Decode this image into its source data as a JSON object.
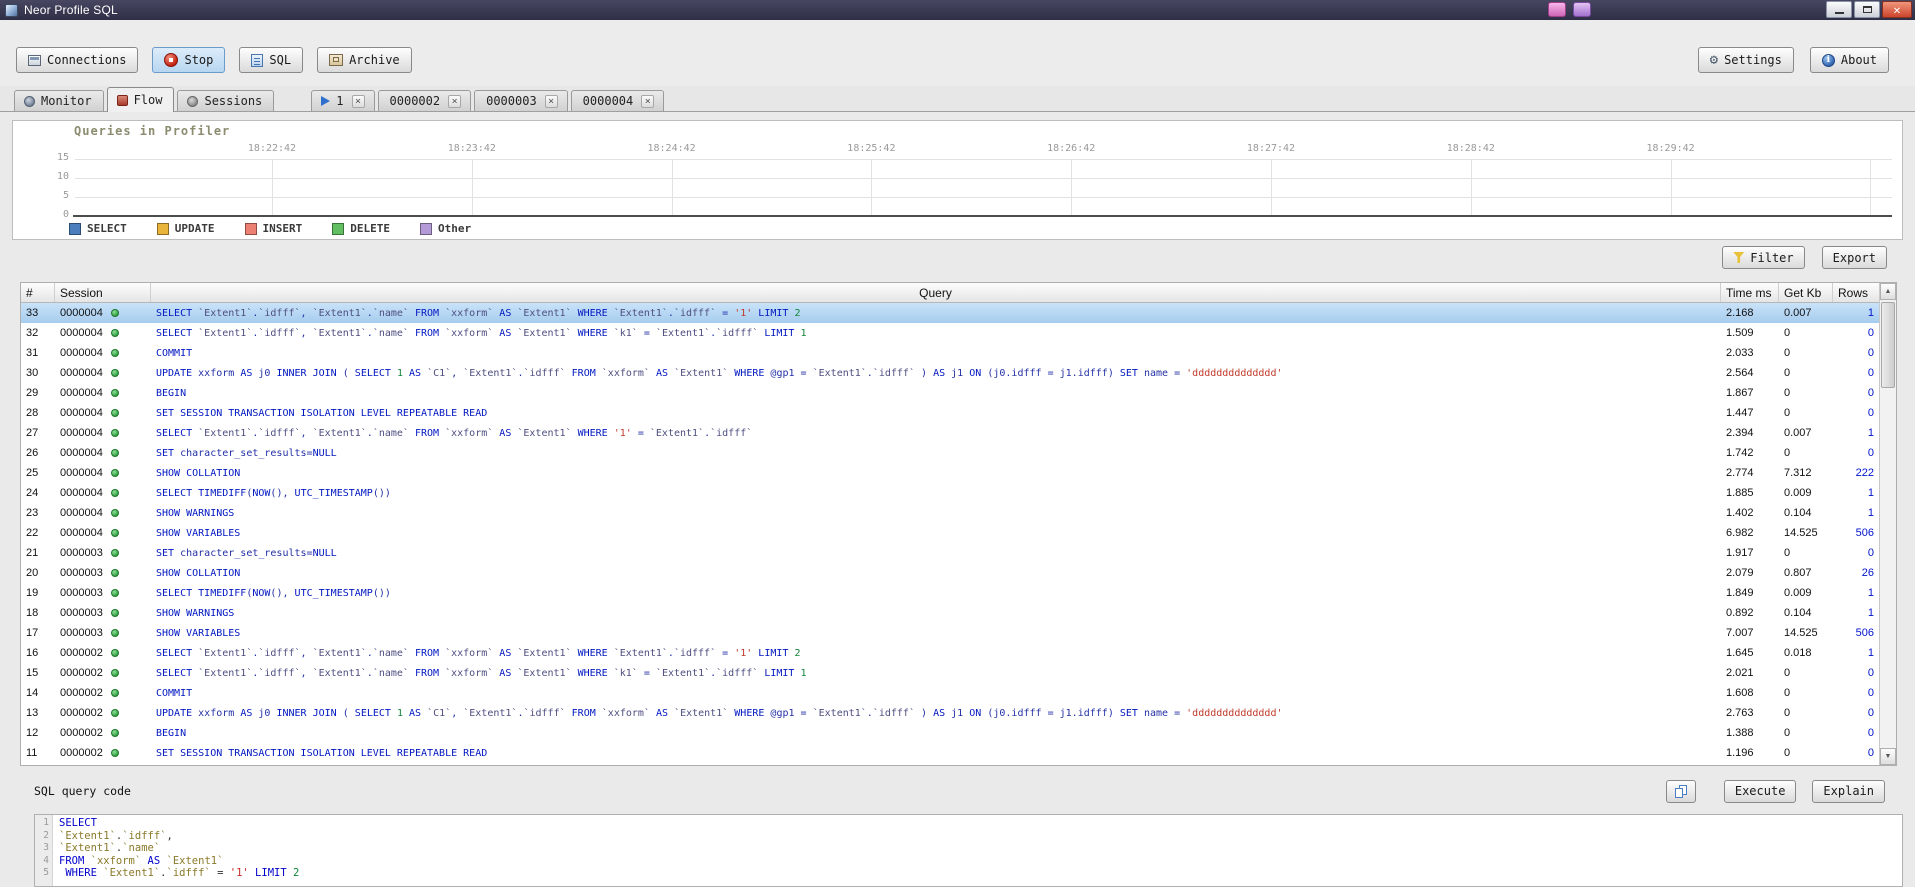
{
  "window": {
    "title": "Neor Profile SQL"
  },
  "toolbar": {
    "connections": "Connections",
    "stop": "Stop",
    "sql": "SQL",
    "archive": "Archive",
    "settings": "Settings",
    "about": "About"
  },
  "tabs": [
    {
      "label": "Monitor",
      "icon": "monitor"
    },
    {
      "label": "Flow",
      "icon": "flow",
      "active": true
    },
    {
      "label": "Sessions",
      "icon": "sessions"
    },
    {
      "label": "1",
      "icon": "play",
      "closable": true,
      "gap_before": true
    },
    {
      "label": "0000002",
      "closable": true
    },
    {
      "label": "0000003",
      "closable": true
    },
    {
      "label": "0000004",
      "closable": true
    }
  ],
  "profiler_chart": {
    "title": "Queries in Profiler",
    "type": "line",
    "x_labels": [
      "18:22:42",
      "18:23:42",
      "18:24:42",
      "18:25:42",
      "18:26:42",
      "18:27:42",
      "18:28:42",
      "18:29:42"
    ],
    "y_labels": [
      "15",
      "10",
      "5",
      "0"
    ],
    "y_range": [
      0,
      15
    ],
    "grid": true,
    "legend": [
      {
        "label": "SELECT",
        "color": "#4a7ebc"
      },
      {
        "label": "UPDATE",
        "color": "#e9b53a"
      },
      {
        "label": "INSERT",
        "color": "#ec8073"
      },
      {
        "label": "DELETE",
        "color": "#61bf61"
      },
      {
        "label": "Other",
        "color": "#b49bd8"
      }
    ]
  },
  "table": {
    "filter_label": "Filter",
    "export_label": "Export",
    "headers": {
      "num": "#",
      "session": "Session",
      "query": "Query",
      "time": "Time ms",
      "kb": "Get Kb",
      "rows": "Rows"
    },
    "rows": [
      {
        "num": 33,
        "session": "0000004",
        "query": "SELECT `Extent1`.`idfff`, `Extent1`.`name` FROM `xxform` AS `Extent1` WHERE `Extent1`.`idfff` = '1' LIMIT 2",
        "time": "2.168",
        "kb": "0.007",
        "rows": "1",
        "selected": true
      },
      {
        "num": 32,
        "session": "0000004",
        "query": "SELECT `Extent1`.`idfff`, `Extent1`.`name` FROM `xxform` AS `Extent1` WHERE `k1` = `Extent1`.`idfff` LIMIT 1",
        "time": "1.509",
        "kb": "0",
        "rows": "0"
      },
      {
        "num": 31,
        "session": "0000004",
        "query": "COMMIT",
        "time": "2.033",
        "kb": "0",
        "rows": "0"
      },
      {
        "num": 30,
        "session": "0000004",
        "query": "UPDATE xxform AS j0 INNER JOIN ( SELECT 1 AS `C1`, `Extent1`.`idfff` FROM `xxform` AS `Extent1` WHERE @gp1 = `Extent1`.`idfff` ) AS j1 ON (j0.idfff = j1.idfff) SET name = 'dddddddddddddd'",
        "time": "2.564",
        "kb": "0",
        "rows": "0"
      },
      {
        "num": 29,
        "session": "0000004",
        "query": "BEGIN",
        "time": "1.867",
        "kb": "0",
        "rows": "0"
      },
      {
        "num": 28,
        "session": "0000004",
        "query": "SET SESSION TRANSACTION ISOLATION LEVEL REPEATABLE READ",
        "time": "1.447",
        "kb": "0",
        "rows": "0"
      },
      {
        "num": 27,
        "session": "0000004",
        "query": "SELECT `Extent1`.`idfff`, `Extent1`.`name` FROM `xxform` AS `Extent1` WHERE '1' = `Extent1`.`idfff`",
        "time": "2.394",
        "kb": "0.007",
        "rows": "1"
      },
      {
        "num": 26,
        "session": "0000004",
        "query": "SET character_set_results=NULL",
        "time": "1.742",
        "kb": "0",
        "rows": "0"
      },
      {
        "num": 25,
        "session": "0000004",
        "query": "SHOW COLLATION",
        "time": "2.774",
        "kb": "7.312",
        "rows": "222"
      },
      {
        "num": 24,
        "session": "0000004",
        "query": "SELECT TIMEDIFF(NOW(), UTC_TIMESTAMP())",
        "time": "1.885",
        "kb": "0.009",
        "rows": "1"
      },
      {
        "num": 23,
        "session": "0000004",
        "query": "SHOW WARNINGS",
        "time": "1.402",
        "kb": "0.104",
        "rows": "1"
      },
      {
        "num": 22,
        "session": "0000004",
        "query": "SHOW VARIABLES",
        "time": "6.982",
        "kb": "14.525",
        "rows": "506"
      },
      {
        "num": 21,
        "session": "0000003",
        "query": "SET character_set_results=NULL",
        "time": "1.917",
        "kb": "0",
        "rows": "0"
      },
      {
        "num": 20,
        "session": "0000003",
        "query": "SHOW COLLATION",
        "time": "2.079",
        "kb": "0.807",
        "rows": "26"
      },
      {
        "num": 19,
        "session": "0000003",
        "query": "SELECT TIMEDIFF(NOW(), UTC_TIMESTAMP())",
        "time": "1.849",
        "kb": "0.009",
        "rows": "1"
      },
      {
        "num": 18,
        "session": "0000003",
        "query": "SHOW WARNINGS",
        "time": "0.892",
        "kb": "0.104",
        "rows": "1"
      },
      {
        "num": 17,
        "session": "0000003",
        "query": "SHOW VARIABLES",
        "time": "7.007",
        "kb": "14.525",
        "rows": "506"
      },
      {
        "num": 16,
        "session": "0000002",
        "query": "SELECT `Extent1`.`idfff`, `Extent1`.`name` FROM `xxform` AS `Extent1` WHERE `Extent1`.`idfff` = '1' LIMIT 2",
        "time": "1.645",
        "kb": "0.018",
        "rows": "1"
      },
      {
        "num": 15,
        "session": "0000002",
        "query": "SELECT `Extent1`.`idfff`, `Extent1`.`name` FROM `xxform` AS `Extent1` WHERE `k1` = `Extent1`.`idfff` LIMIT 1",
        "time": "2.021",
        "kb": "0",
        "rows": "0"
      },
      {
        "num": 14,
        "session": "0000002",
        "query": "COMMIT",
        "time": "1.608",
        "kb": "0",
        "rows": "0"
      },
      {
        "num": 13,
        "session": "0000002",
        "query": "UPDATE xxform AS j0 INNER JOIN ( SELECT 1 AS `C1`, `Extent1`.`idfff` FROM `xxform` AS `Extent1` WHERE @gp1 = `Extent1`.`idfff` ) AS j1 ON (j0.idfff = j1.idfff) SET name = 'dddddddddddddd'",
        "time": "2.763",
        "kb": "0",
        "rows": "0"
      },
      {
        "num": 12,
        "session": "0000002",
        "query": "BEGIN",
        "time": "1.388",
        "kb": "0",
        "rows": "0"
      },
      {
        "num": 11,
        "session": "0000002",
        "query": "SET SESSION TRANSACTION ISOLATION LEVEL REPEATABLE READ",
        "time": "1.196",
        "kb": "0",
        "rows": "0"
      }
    ]
  },
  "sql_editor": {
    "title": "SQL query code",
    "execute_label": "Execute",
    "explain_label": "Explain",
    "lines": [
      "SELECT",
      "`Extent1`.`idfff`,",
      "`Extent1`.`name`",
      "FROM `xxform` AS `Extent1`",
      " WHERE `Extent1`.`idfff` = '1' LIMIT 2"
    ]
  }
}
